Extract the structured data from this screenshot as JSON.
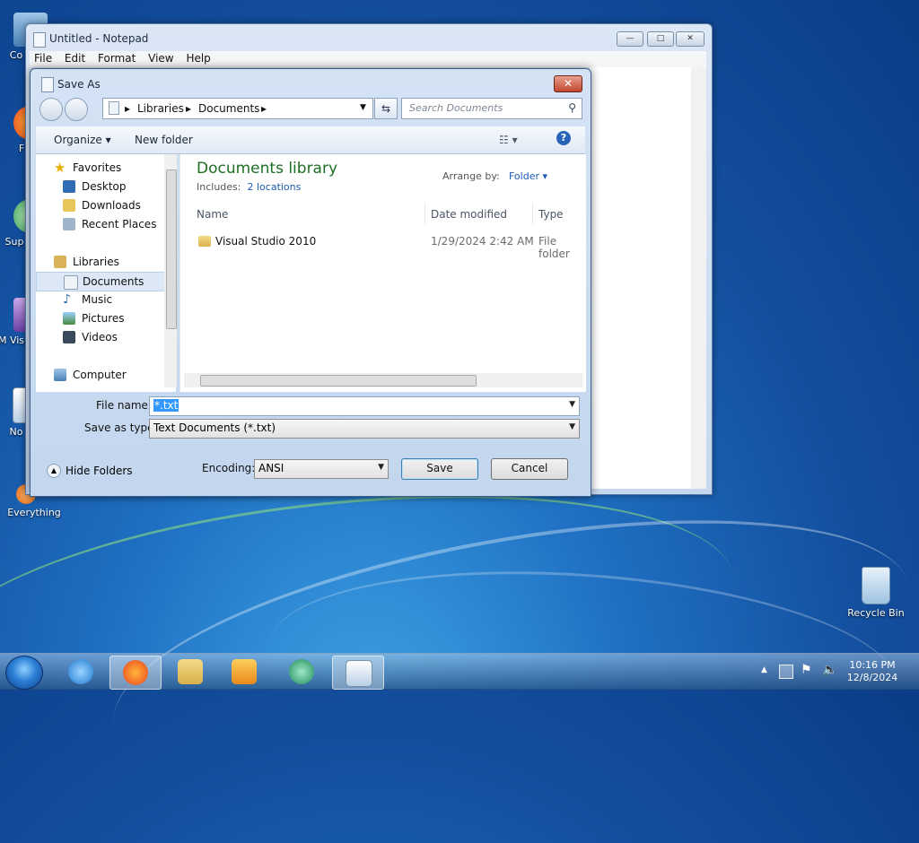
{
  "desktop": {
    "icons": [
      {
        "label": "Co"
      },
      {
        "label": "F"
      },
      {
        "label": "Sup"
      },
      {
        "label": "M Visu"
      },
      {
        "label": "No"
      },
      {
        "label": "Everything"
      },
      {
        "label": "Recycle Bin"
      }
    ]
  },
  "notepad": {
    "title": "Untitled - Notepad",
    "menu": [
      "File",
      "Edit",
      "Format",
      "View",
      "Help"
    ],
    "controls": {
      "minimize": "—",
      "maximize": "□",
      "close": "✕"
    }
  },
  "dialog": {
    "title": "Save As",
    "close_label": "✕",
    "address": {
      "crumb1": "Libraries",
      "crumb2": "Documents"
    },
    "search_placeholder": "Search Documents",
    "toolbar": {
      "organize": "Organize",
      "new_folder": "New folder"
    },
    "nav": {
      "favorites": "Favorites",
      "desktop": "Desktop",
      "downloads": "Downloads",
      "recent_places": "Recent Places",
      "libraries": "Libraries",
      "documents": "Documents",
      "music": "Music",
      "pictures": "Pictures",
      "videos": "Videos",
      "computer": "Computer"
    },
    "library": {
      "title": "Documents library",
      "includes_label": "Includes:",
      "includes_link": "2 locations",
      "arrange_label": "Arrange by:",
      "arrange_value": "Folder"
    },
    "columns": {
      "name": "Name",
      "date": "Date modified",
      "type": "Type"
    },
    "files": [
      {
        "name": "Visual Studio 2010",
        "date": "1/29/2024 2:42 AM",
        "type": "File folder"
      }
    ],
    "file_name_label": "File name:",
    "file_name_value": "*.txt",
    "save_type_label": "Save as type:",
    "save_type_value": "Text Documents (*.txt)",
    "hide_folders": "Hide Folders",
    "encoding_label": "Encoding:",
    "encoding_value": "ANSI",
    "save_button": "Save",
    "cancel_button": "Cancel"
  },
  "taskbar": {
    "apps": [
      "Internet Explorer",
      "Firefox",
      "File Explorer",
      "Media Player",
      "App",
      "Notepad"
    ],
    "clock": {
      "time": "10:16 PM",
      "date": "12/8/2024"
    }
  }
}
